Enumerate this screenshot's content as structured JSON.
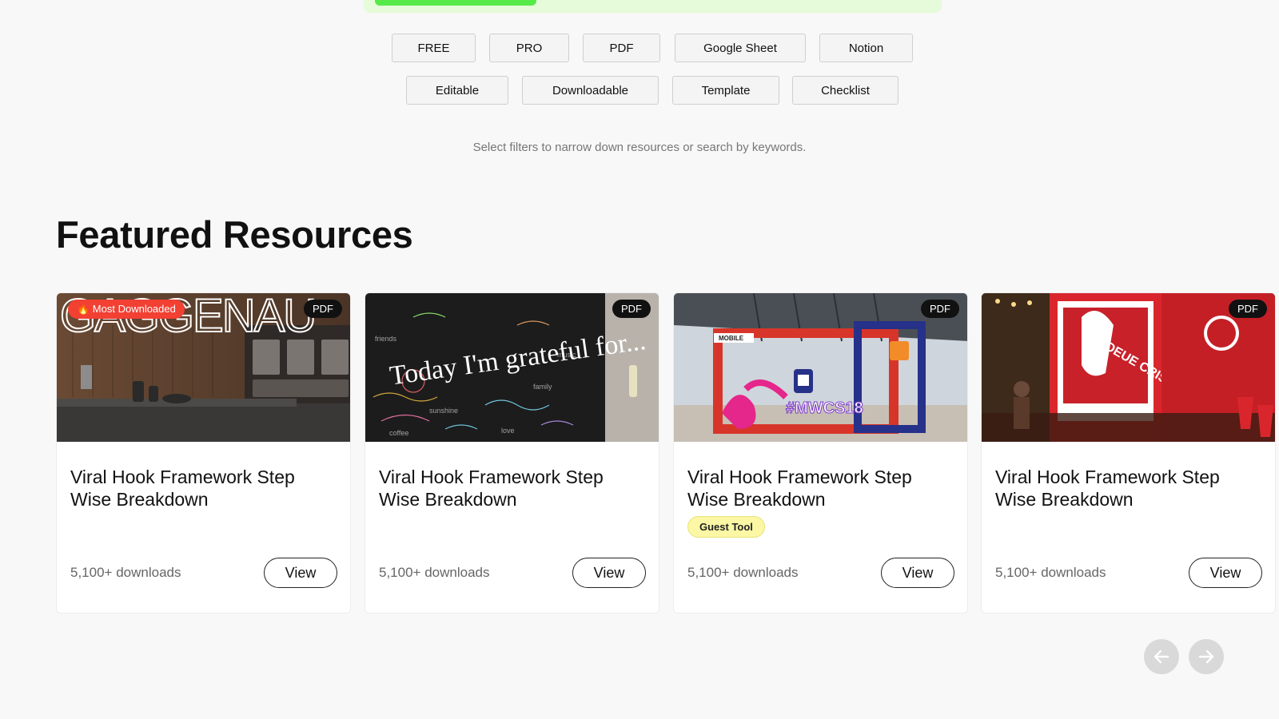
{
  "progress": {
    "fraction": 0.29,
    "color": "#55ea4a"
  },
  "filters": {
    "row1": [
      "FREE",
      "PRO",
      "PDF",
      "Google Sheet",
      "Notion"
    ],
    "row2": [
      "Editable",
      "Downloadable",
      "Template",
      "Checklist"
    ]
  },
  "hint": "Select filters to narrow down resources or search by keywords.",
  "featured": {
    "title": "Featured Resources",
    "cards": [
      {
        "title": "Viral Hook Framework Step Wise Breakdown",
        "badge": "PDF",
        "flag": "🔥 Most Downloaded",
        "image_text": "GAGGENAU",
        "downloads": "5,100+ downloads",
        "view_label": "View"
      },
      {
        "title": "Viral Hook Framework Step Wise Breakdown",
        "badge": "PDF",
        "image_text": "Today I'm grateful for...",
        "downloads": "5,100+ downloads",
        "view_label": "View"
      },
      {
        "title": "Viral Hook Framework Step Wise Breakdown",
        "badge": "PDF",
        "image_text": "#MWCS18",
        "image_text_2": "MOBILE",
        "tag": "Guest Tool",
        "downloads": "5,100+ downloads",
        "view_label": "View"
      },
      {
        "title": "Viral Hook Framework Step Wise Breakdown",
        "badge": "PDF",
        "image_text": "DEUE CRISH",
        "downloads": "5,100+ downloads",
        "view_label": "View"
      }
    ]
  },
  "carousel": {
    "prev_icon": "arrow-left-icon",
    "next_icon": "arrow-right-icon"
  },
  "colors": {
    "accent_green": "#55ea4a",
    "hot_badge": "#f24033",
    "guest_tag": "#fbf7a4"
  }
}
